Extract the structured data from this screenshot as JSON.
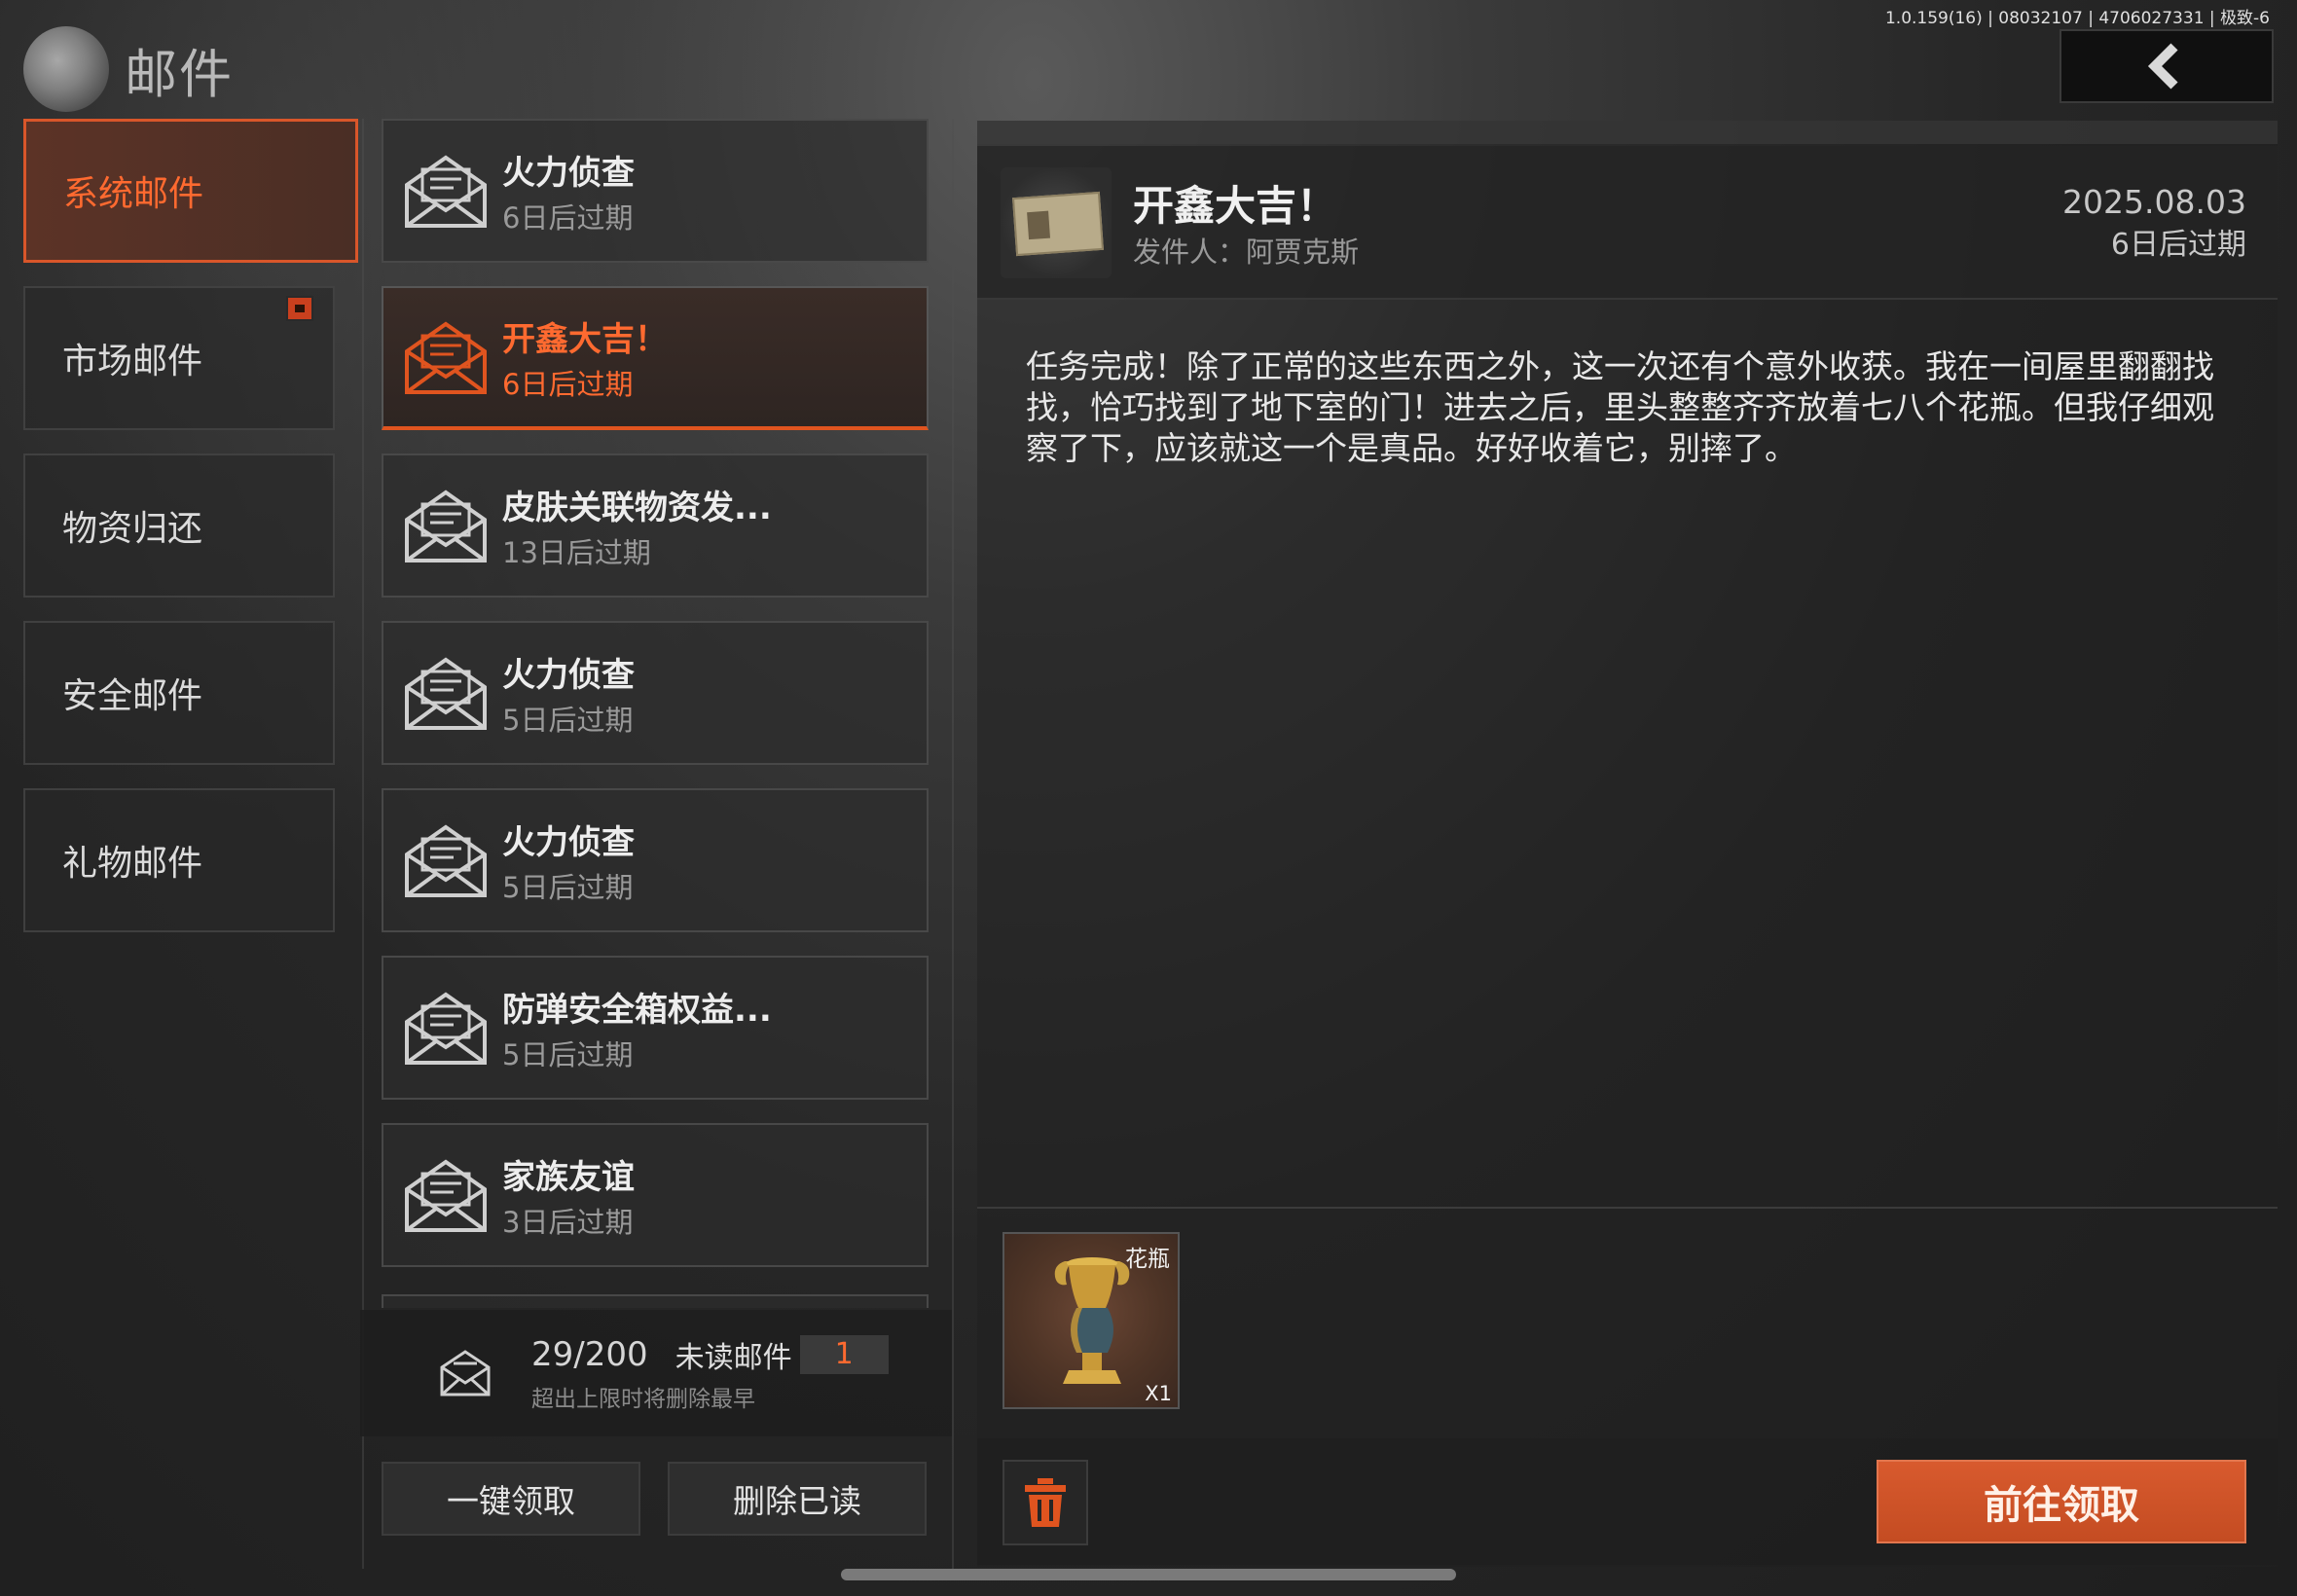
{
  "version": "1.0.159(16) | 08032107 | 4706027331 | 极致-6",
  "header": {
    "title": "邮件"
  },
  "categories": [
    {
      "label": "系统邮件",
      "active": true
    },
    {
      "label": "市场邮件",
      "active": false,
      "badge": true
    },
    {
      "label": "物资归还",
      "active": false
    },
    {
      "label": "安全邮件",
      "active": false
    },
    {
      "label": "礼物邮件",
      "active": false
    }
  ],
  "mails": [
    {
      "title": "火力侦查",
      "expiry": "6日后过期",
      "active": false
    },
    {
      "title": "开鑫大吉！",
      "expiry": "6日后过期",
      "active": true
    },
    {
      "title": "皮肤关联物资发...",
      "expiry": "13日后过期",
      "active": false
    },
    {
      "title": "火力侦查",
      "expiry": "5日后过期",
      "active": false
    },
    {
      "title": "火力侦查",
      "expiry": "5日后过期",
      "active": false
    },
    {
      "title": "防弹安全箱权益...",
      "expiry": "5日后过期",
      "active": false
    },
    {
      "title": "家族友谊",
      "expiry": "3日后过期",
      "active": false
    }
  ],
  "summary": {
    "count": "29/200",
    "unread_label": "未读邮件",
    "unread_value": "1",
    "note": "超出上限时将删除最早"
  },
  "actions": {
    "claim_all": "一键领取",
    "delete_read": "删除已读",
    "go_claim": "前往领取"
  },
  "detail": {
    "title": "开鑫大吉！",
    "sender": "发件人：阿贾克斯",
    "date": "2025.08.03",
    "expiry": "6日后过期",
    "body": "任务完成！除了正常的这些东西之外，这一次还有个意外收获。我在一间屋里翻翻找找，恰巧找到了地下室的门！进去之后，里头整整齐齐放着七八个花瓶。但我仔细观察了下，应该就这一个是真品。好好收着它，别摔了。",
    "attachment": {
      "name": "花瓶",
      "qty": "X1",
      "icon": "vase-icon"
    }
  },
  "colors": {
    "accent": "#e0541f",
    "accent_text": "#ff6a30",
    "claim_button": "#c9522a"
  }
}
